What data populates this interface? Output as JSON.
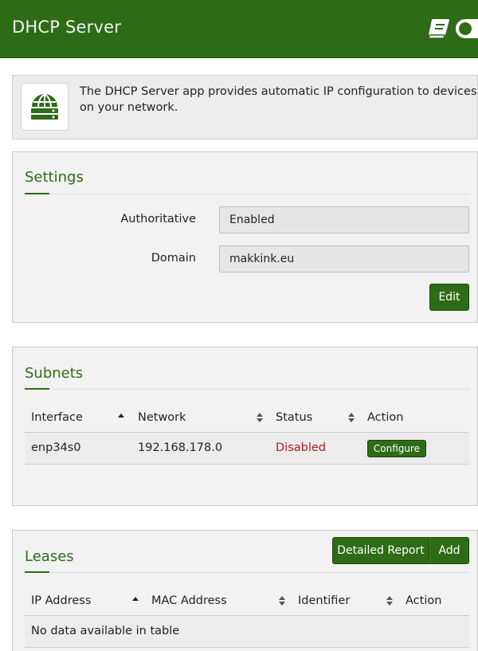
{
  "header": {
    "title": "DHCP Server",
    "manual_icon": "book-icon",
    "toggle_icon": "toggle-switch-icon",
    "brand_color": "#2e6b16"
  },
  "intro": {
    "app_icon": "network-server-icon",
    "description": "The DHCP Server app provides automatic IP configuration to devices on your network."
  },
  "settings": {
    "title": "Settings",
    "fields": [
      {
        "label": "Authoritative",
        "value": "Enabled"
      },
      {
        "label": "Domain",
        "value": "makkink.eu"
      }
    ],
    "edit_label": "Edit"
  },
  "subnets": {
    "title": "Subnets",
    "columns": [
      "Interface",
      "Network",
      "Status",
      "Action"
    ],
    "rows": [
      {
        "interface": "enp34s0",
        "network": "192.168.178.0",
        "status": "Disabled",
        "action": "Configure"
      }
    ],
    "status_disabled_color": "#b01c1c"
  },
  "leases": {
    "title": "Leases",
    "buttons": {
      "detailed_report": "Detailed Report",
      "add": "Add"
    },
    "columns": [
      "IP Address",
      "MAC Address",
      "Identifier",
      "Action"
    ],
    "empty_message": "No data available in table"
  }
}
